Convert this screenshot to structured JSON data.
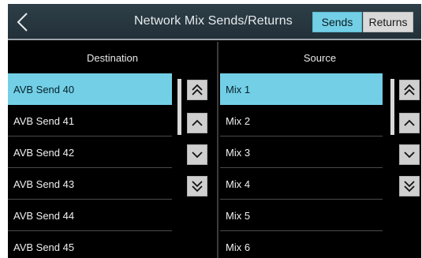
{
  "header": {
    "title": "Network Mix Sends/Returns",
    "back_icon": "chevron-left-icon",
    "tabs": [
      {
        "label": "Sends",
        "selected": true
      },
      {
        "label": "Returns",
        "selected": false
      }
    ]
  },
  "destination": {
    "header": "Destination",
    "items": [
      {
        "label": "AVB Send 40",
        "selected": true
      },
      {
        "label": "AVB Send 41",
        "selected": false
      },
      {
        "label": "AVB Send 42",
        "selected": false
      },
      {
        "label": "AVB Send 43",
        "selected": false
      },
      {
        "label": "AVB Send 44",
        "selected": false
      },
      {
        "label": "AVB Send 45",
        "selected": false
      }
    ]
  },
  "source": {
    "header": "Source",
    "items": [
      {
        "label": "Mix 1",
        "selected": true
      },
      {
        "label": "Mix 2",
        "selected": false
      },
      {
        "label": "Mix 3",
        "selected": false
      },
      {
        "label": "Mix 4",
        "selected": false
      },
      {
        "label": "Mix 5",
        "selected": false
      },
      {
        "label": "Mix 6",
        "selected": false
      }
    ]
  },
  "nav_icons": [
    "double-chevron-up-icon",
    "chevron-up-icon",
    "chevron-down-icon",
    "double-chevron-down-icon"
  ],
  "colors": {
    "accent": "#72cfe6",
    "header_bg": "#2a3a42",
    "list_bg": "#000000",
    "button_bg": "#cfcfcf"
  }
}
